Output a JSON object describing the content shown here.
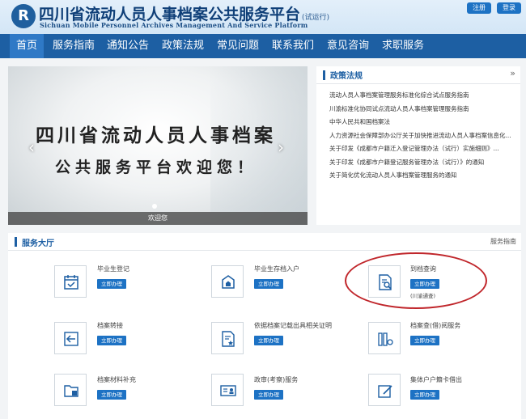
{
  "header": {
    "logo_glyph": "R",
    "title": "四川省流动人员人事档案公共服务平台",
    "title_suffix": "(试运行)",
    "subtitle": "Sichuan Mobile Personnel Archives Management And Service Platform",
    "register_label": "注册",
    "login_label": "登录"
  },
  "nav": {
    "items": [
      "首页",
      "服务指南",
      "通知公告",
      "政策法规",
      "常见问题",
      "联系我们",
      "意见咨询",
      "求职服务"
    ]
  },
  "banner": {
    "line1": "四川省流动人员人事档案",
    "line2": "公共服务平台欢迎您！",
    "caption": "欢迎您",
    "prev_glyph": "‹",
    "next_glyph": "›"
  },
  "policy": {
    "title": "政策法规",
    "more_glyph": "»",
    "items": [
      "流动人员人事档案管理服务标准化综合试点服务指南",
      "川渝标准化协同试点流动人员人事档案管理服务指南",
      "中华人民共和国档案法",
      "人力资源社会保障部办公厅关于加快推进流动人员人事档案信息化...",
      "关于印发《成都市户籍迁入登记管理办法（试行）实施细则》...",
      "关于印发《成都市户籍登记服务管理办法（试行）》的通知",
      "关于简化优化流动人员人事档案管理服务的通知"
    ]
  },
  "service": {
    "title": "服务大厅",
    "guide_label": "服务指南",
    "action_label": "立即办理",
    "items": [
      {
        "name": "毕业生登记",
        "icon": "calendar-check-icon"
      },
      {
        "name": "毕业生存档入户",
        "icon": "home-icon"
      },
      {
        "name": "到档查询",
        "icon": "document-search-icon",
        "note": "(川渝通查)"
      },
      {
        "name": "档案转接",
        "icon": "transfer-icon"
      },
      {
        "name": "依据档案记载出具相关证明",
        "icon": "certificate-icon"
      },
      {
        "name": "档案查(借)阅服务",
        "icon": "books-icon"
      },
      {
        "name": "档案材料补充",
        "icon": "folder-add-icon"
      },
      {
        "name": "政审(考察)服务",
        "icon": "id-card-icon"
      },
      {
        "name": "集体户户籍卡借出",
        "icon": "edit-card-icon"
      }
    ]
  },
  "colors": {
    "nav_bg": "#1d5fa3",
    "accent": "#1d72c4",
    "highlight": "#c0262b"
  }
}
